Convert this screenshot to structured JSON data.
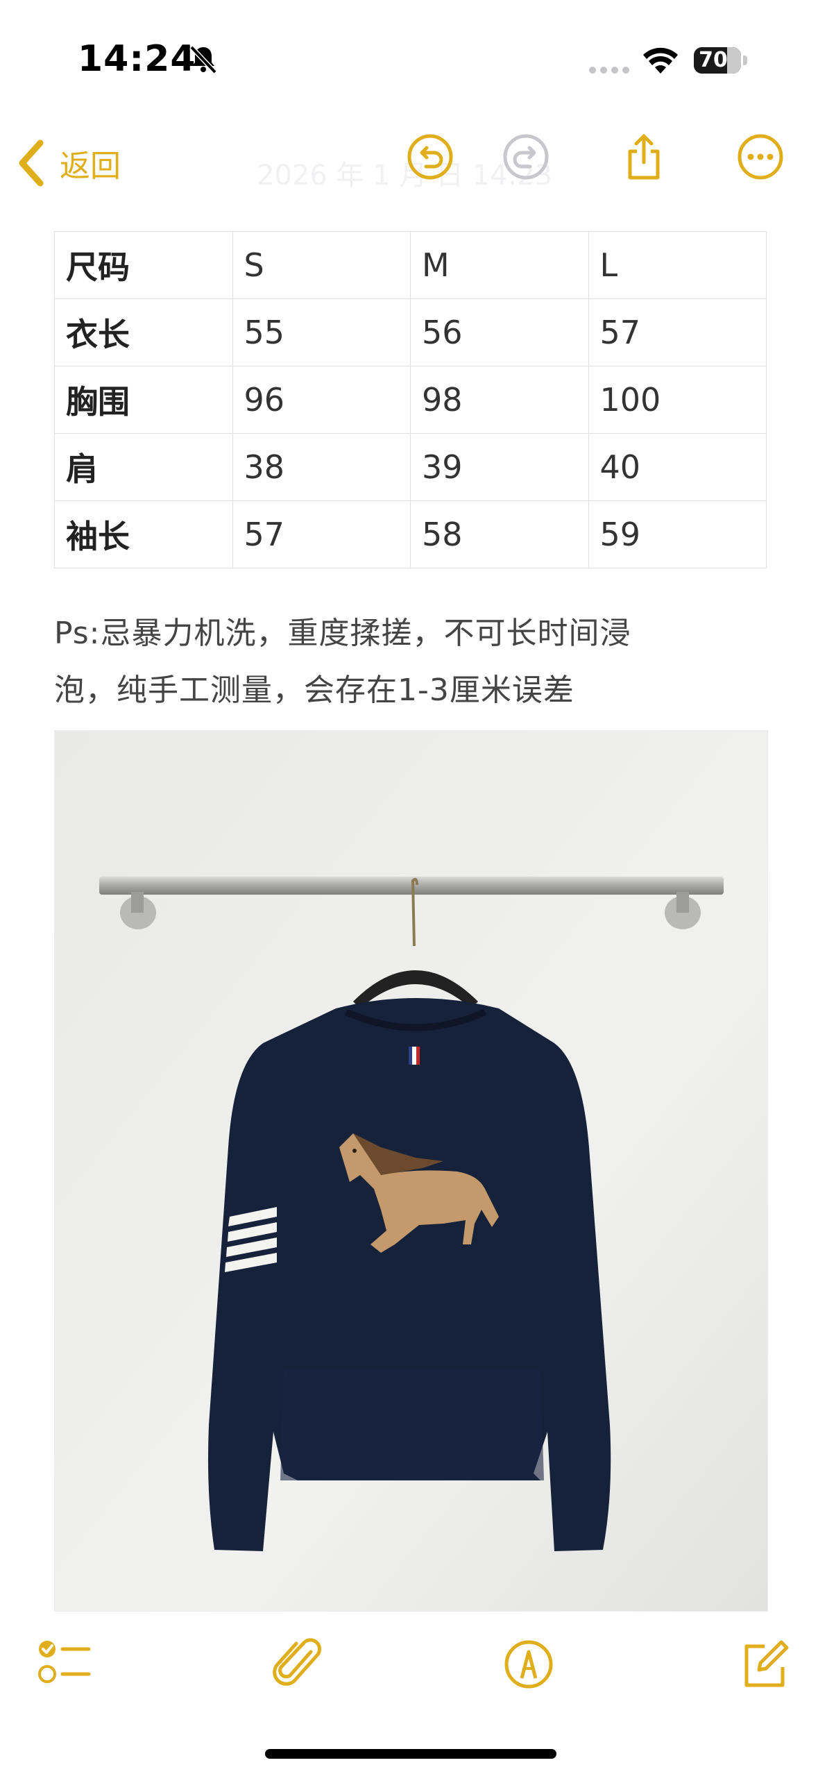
{
  "status_bar": {
    "time": "14:24",
    "battery_level": "70",
    "battery_fraction": 0.7
  },
  "nav": {
    "back_label": "返回",
    "faint_date": "2026 年 1 月 日 14:23",
    "accent_color": "#e0ad1b"
  },
  "size_table": {
    "rows": [
      [
        "尺码",
        "S",
        "M",
        "L"
      ],
      [
        "衣长",
        "55",
        "56",
        "57"
      ],
      [
        "胸围",
        "96",
        "98",
        "100"
      ],
      [
        "肩",
        "38",
        "39",
        "40"
      ],
      [
        "袖长",
        "57",
        "58",
        "59"
      ]
    ]
  },
  "note": {
    "line1": "Ps:忌暴力机洗，重度揉搓，不可长时间浸",
    "line2": "泡，纯手工测量，会存在1-3厘米误差"
  },
  "icons": {
    "back": "chevron-left-icon",
    "undo": "undo-icon",
    "redo": "redo-icon",
    "share": "share-icon",
    "more": "more-icon",
    "checklist": "checklist-icon",
    "attachment": "paperclip-icon",
    "markup": "markup-pen-icon",
    "compose": "compose-icon"
  }
}
